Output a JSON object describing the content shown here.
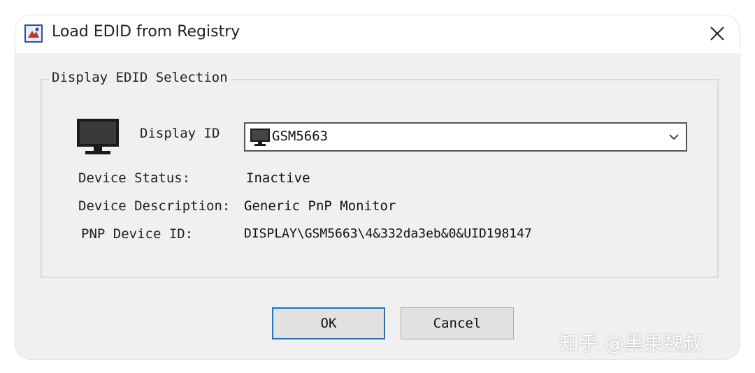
{
  "window": {
    "title": "Load EDID from Registry",
    "close_icon": "close-icon"
  },
  "group": {
    "legend": "Display EDID Selection"
  },
  "display_id": {
    "label": "Display ID",
    "selected": "GSM5663"
  },
  "device": {
    "status_label": "Device Status:",
    "status_value": "Inactive",
    "description_label": "Device Description:",
    "description_value": "Generic PnP Monitor",
    "pnp_label": "PNP Device ID:",
    "pnp_value": "DISPLAY\\GSM5663\\4&332da3eb&0&UID198147"
  },
  "buttons": {
    "ok": "OK",
    "cancel": "Cancel"
  },
  "watermark": {
    "text": "知乎 @黑果魏叔"
  },
  "colors": {
    "dialog_bg": "#f0f0f0",
    "focus_border": "#0a78d7"
  }
}
